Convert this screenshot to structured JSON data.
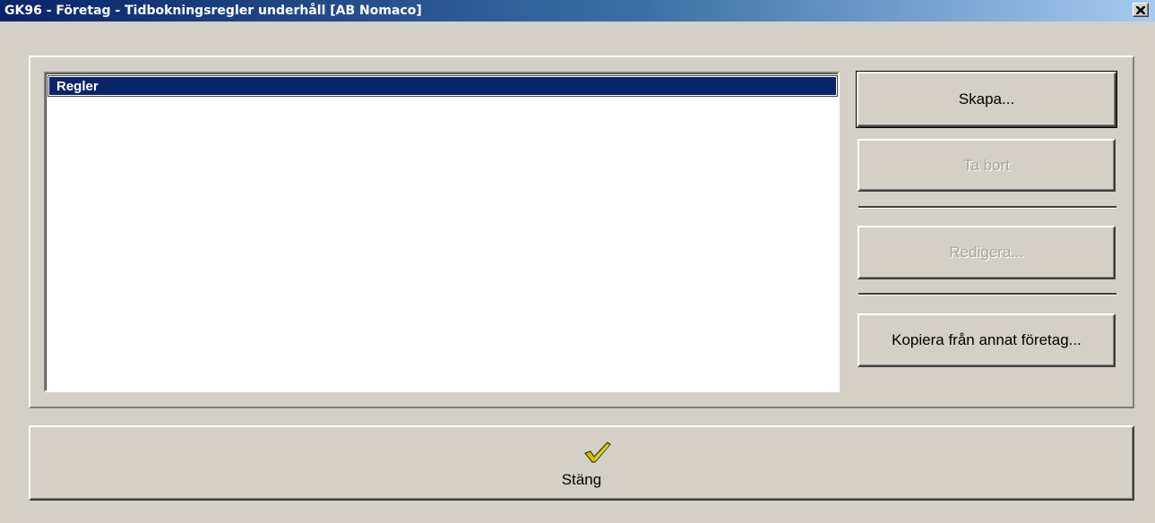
{
  "window": {
    "title": "GK96 - Företag - Tidbokningsregler underhåll [AB Nomaco]",
    "close_glyph": "×"
  },
  "list": {
    "header": "Regler",
    "items": []
  },
  "buttons": {
    "create": "Skapa...",
    "delete": "Ta bort",
    "edit": "Redigera...",
    "copy": "Kopiera från annat företag..."
  },
  "footer": {
    "close_label": "Stäng",
    "close_icon": "checkmark-icon"
  },
  "colors": {
    "title_bar_start": "#0a246a",
    "title_bar_end": "#a6caf0",
    "face": "#d4d0c8",
    "list_header": "#0a246a",
    "check_fill": "#c8c000"
  }
}
